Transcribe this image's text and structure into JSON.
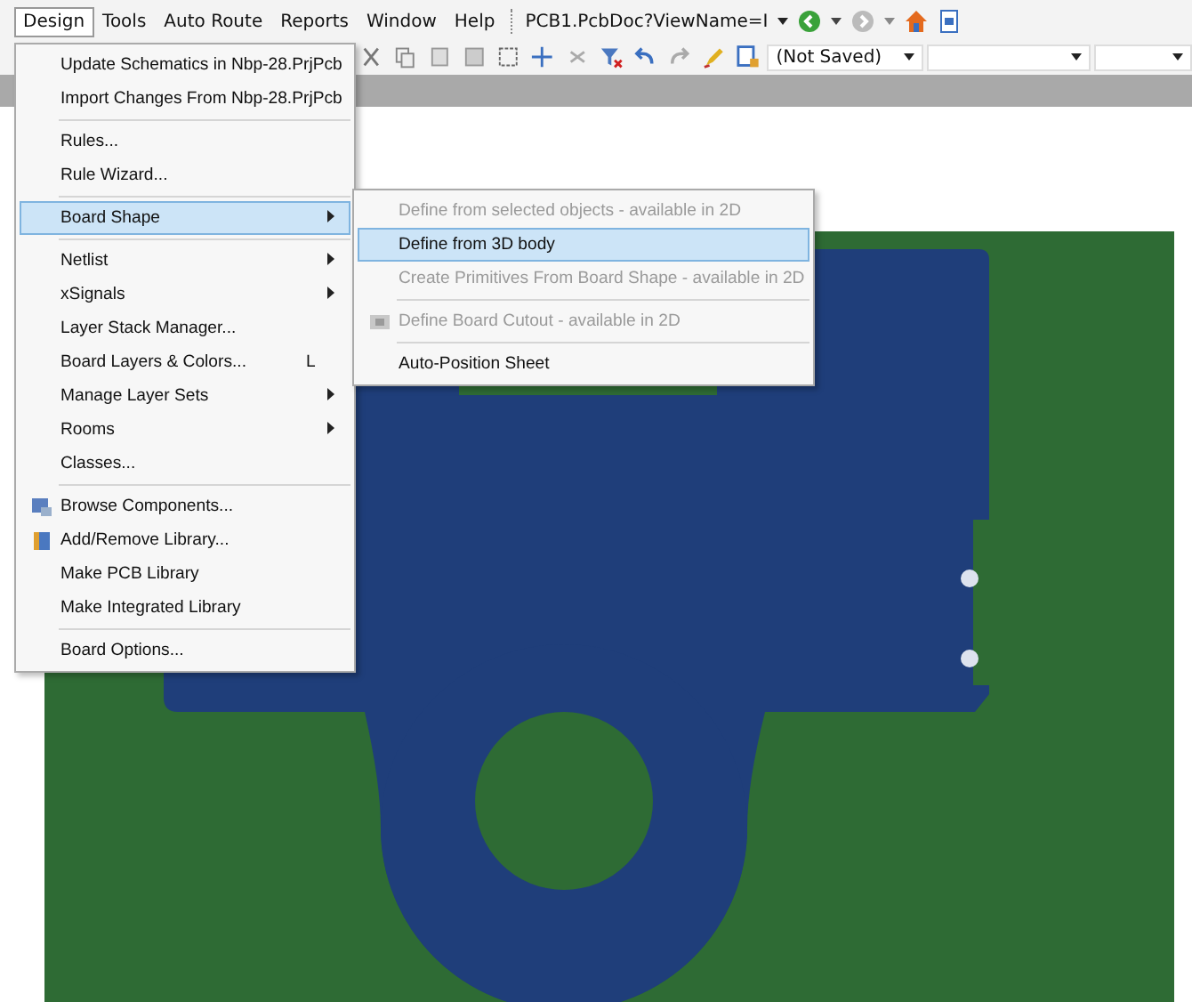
{
  "menu_bar": [
    {
      "label": "Design",
      "selected": true
    },
    {
      "label": "Tools",
      "selected": false
    },
    {
      "label": "Auto Route",
      "selected": false
    },
    {
      "label": "Reports",
      "selected": false
    },
    {
      "label": "Window",
      "selected": false
    },
    {
      "label": "Help",
      "selected": false
    }
  ],
  "document_combo": {
    "value": "PCB1.PcbDoc?ViewName=I"
  },
  "toolbar": {
    "state_combo": {
      "value": "(Not Saved)"
    }
  },
  "design_menu": [
    {
      "kind": "item",
      "label": "Update Schematics in Nbp-28.PrjPcb",
      "selected": false,
      "submenu": false
    },
    {
      "kind": "item",
      "label": "Import Changes From Nbp-28.PrjPcb",
      "selected": false,
      "submenu": false
    },
    {
      "kind": "separator"
    },
    {
      "kind": "item",
      "label": "Rules...",
      "selected": false,
      "submenu": false
    },
    {
      "kind": "item",
      "label": "Rule Wizard...",
      "selected": false,
      "submenu": false
    },
    {
      "kind": "separator"
    },
    {
      "kind": "item",
      "label": "Board Shape",
      "selected": true,
      "submenu": true
    },
    {
      "kind": "separator"
    },
    {
      "kind": "item",
      "label": "Netlist",
      "selected": false,
      "submenu": true
    },
    {
      "kind": "item",
      "label": "xSignals",
      "selected": false,
      "submenu": true
    },
    {
      "kind": "item",
      "label": "Layer Stack Manager...",
      "selected": false,
      "submenu": false
    },
    {
      "kind": "item",
      "label": "Board Layers & Colors...",
      "shortcut": "L",
      "selected": false,
      "submenu": false
    },
    {
      "kind": "item",
      "label": "Manage Layer Sets",
      "selected": false,
      "submenu": true
    },
    {
      "kind": "item",
      "label": "Rooms",
      "selected": false,
      "submenu": true
    },
    {
      "kind": "item",
      "label": "Classes...",
      "selected": false,
      "submenu": false
    },
    {
      "kind": "separator"
    },
    {
      "kind": "item",
      "label": "Browse Components...",
      "selected": false,
      "submenu": false
    },
    {
      "kind": "item",
      "label": "Add/Remove Library...",
      "selected": false,
      "submenu": false
    },
    {
      "kind": "item",
      "label": "Make PCB Library",
      "selected": false,
      "submenu": false
    },
    {
      "kind": "item",
      "label": "Make Integrated Library",
      "selected": false,
      "submenu": false
    },
    {
      "kind": "separator"
    },
    {
      "kind": "item",
      "label": "Board Options...",
      "selected": false,
      "submenu": false
    }
  ],
  "board_shape_submenu": [
    {
      "kind": "item",
      "label": "Define from selected objects - available in 2D",
      "selected": false,
      "disabled": true
    },
    {
      "kind": "item",
      "label": "Define from 3D body",
      "selected": true,
      "disabled": false
    },
    {
      "kind": "item",
      "label": "Create Primitives From Board Shape - available in 2D",
      "selected": false,
      "disabled": true
    },
    {
      "kind": "separator"
    },
    {
      "kind": "item",
      "label": "Define Board Cutout - available in 2D",
      "selected": false,
      "disabled": true
    },
    {
      "kind": "separator"
    },
    {
      "kind": "item",
      "label": "Auto-Position Sheet",
      "selected": false,
      "disabled": false
    }
  ]
}
